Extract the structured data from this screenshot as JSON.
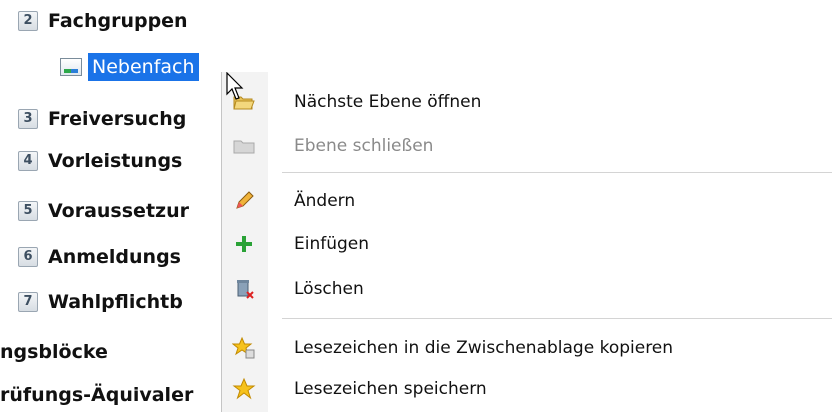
{
  "tree": {
    "items": [
      {
        "num": "2",
        "label": "Fachgruppen"
      },
      {
        "num": "3",
        "label": "Freiversuchg"
      },
      {
        "num": "4",
        "label": "Vorleistungs"
      },
      {
        "num": "5",
        "label": "Voraussetzur"
      },
      {
        "num": "6",
        "label": "Anmeldungs"
      },
      {
        "num": "7",
        "label": "Wahlpflichtb"
      }
    ],
    "selected": {
      "label": "Nebenfach"
    },
    "top_level": [
      "ngsblöcke",
      "rüfungs-Äquivaler"
    ]
  },
  "context_menu": {
    "items": [
      {
        "label": "Nächste Ebene öffnen",
        "icon": "folder-open-icon",
        "enabled": true
      },
      {
        "label": "Ebene schließen",
        "icon": "folder-closed-icon",
        "enabled": false
      },
      {
        "label": "Ändern",
        "icon": "pencil-icon",
        "enabled": true
      },
      {
        "label": "Einfügen",
        "icon": "plus-icon",
        "enabled": true
      },
      {
        "label": "Löschen",
        "icon": "trash-icon",
        "enabled": true
      },
      {
        "label": "Lesezeichen in die Zwischenablage kopieren",
        "icon": "star-copy-icon",
        "enabled": true
      },
      {
        "label": "Lesezeichen speichern",
        "icon": "star-icon",
        "enabled": true
      }
    ]
  },
  "colors": {
    "selection": "#1a73e8",
    "menu_strip": "#f3f3f3"
  }
}
